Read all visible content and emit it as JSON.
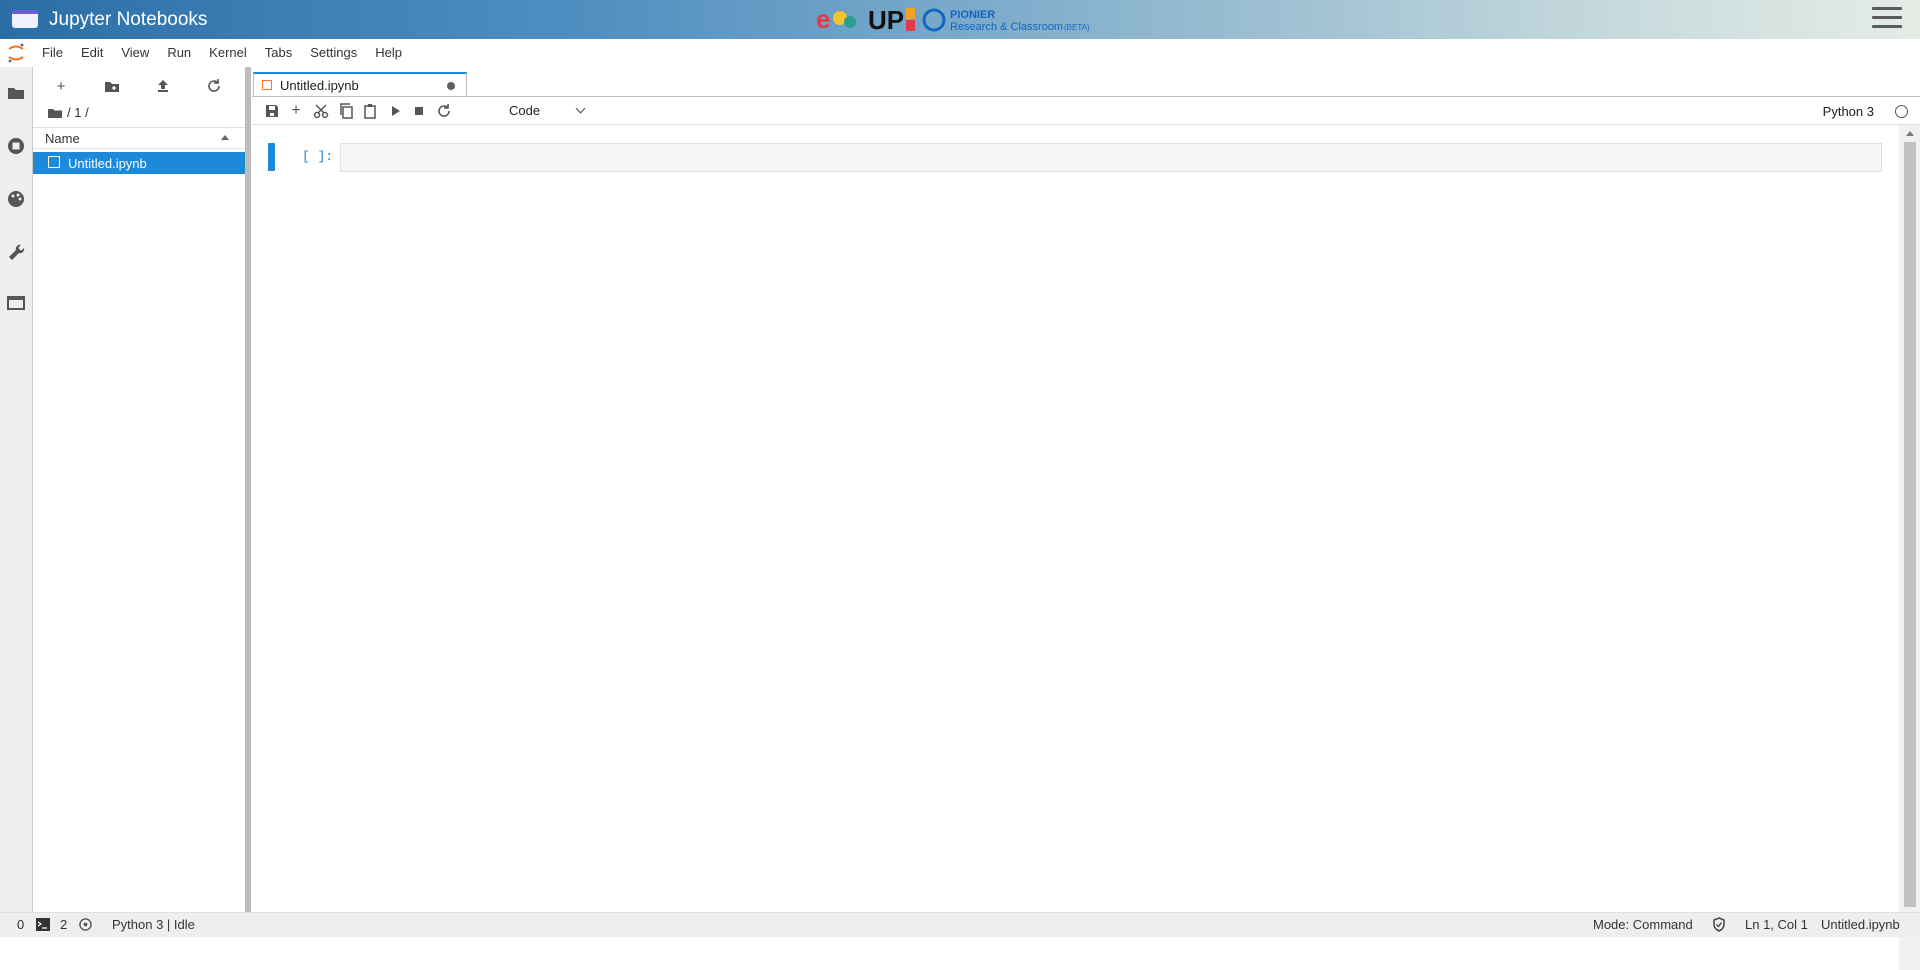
{
  "header": {
    "title": "Jupyter Notebooks",
    "logo_text": "PIONIER",
    "logo_subtext": "Research & Classroom",
    "logo_beta": "(BETA)"
  },
  "menu": [
    "File",
    "Edit",
    "View",
    "Run",
    "Kernel",
    "Tabs",
    "Settings",
    "Help"
  ],
  "sidebar_icons": [
    "folder-icon",
    "running-icon",
    "palette-icon",
    "wrench-icon",
    "tabs-icon"
  ],
  "filebrowser": {
    "breadcrumb": "/ 1 /",
    "column_name": "Name",
    "files": [
      {
        "name": "Untitled.ipynb",
        "selected": true
      }
    ]
  },
  "notebook": {
    "tab_label": "Untitled.ipynb",
    "cell_type": "Code",
    "kernel_name": "Python 3",
    "cells": [
      {
        "prompt": "[ ]:",
        "source": ""
      }
    ]
  },
  "statusbar": {
    "terminals": "0",
    "kernels": "2",
    "kernel_status": "Python 3 | Idle",
    "mode": "Mode: Command",
    "position": "Ln 1, Col 1",
    "file": "Untitled.ipynb"
  },
  "colors": {
    "accent": "#1c8ad8",
    "prompt": "#307fc1",
    "orange": "#f37726"
  }
}
